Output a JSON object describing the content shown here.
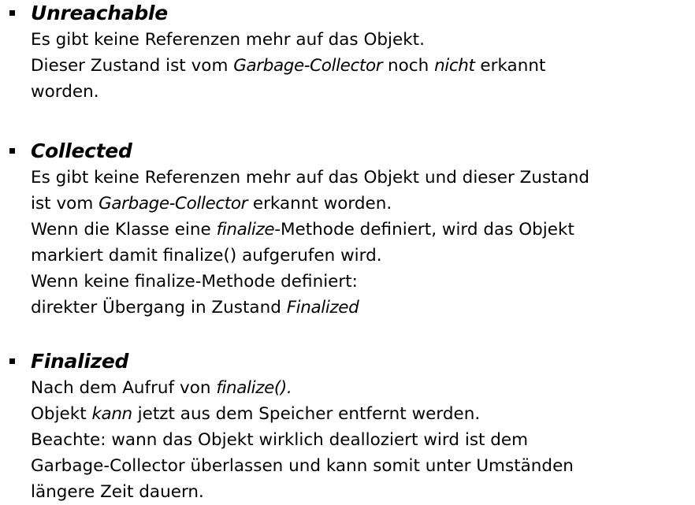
{
  "sections": [
    {
      "heading": "Unreachable",
      "lines": [
        [
          {
            "t": "Es gibt keine Referenzen mehr auf das Objekt."
          }
        ],
        [
          {
            "t": "Dieser Zustand ist vom "
          },
          {
            "t": "Garbage-Collector",
            "i": true
          },
          {
            "t": " noch "
          },
          {
            "t": "nicht",
            "i": true
          },
          {
            "t": " erkannt"
          }
        ],
        [
          {
            "t": "worden."
          }
        ]
      ]
    },
    {
      "heading": "Collected",
      "lines": [
        [
          {
            "t": "Es gibt keine Referenzen mehr auf das Objekt und dieser Zustand"
          }
        ],
        [
          {
            "t": "ist vom "
          },
          {
            "t": "Garbage-Collector",
            "i": true
          },
          {
            "t": " erkannt worden."
          }
        ],
        [
          {
            "t": "Wenn die Klasse eine "
          },
          {
            "t": "finalize",
            "i": true
          },
          {
            "t": "-Methode definiert, wird das Objekt"
          }
        ],
        [
          {
            "t": "markiert damit finalize() aufgerufen wird."
          }
        ],
        [
          {
            "t": "Wenn keine finalize-Methode definiert:"
          }
        ],
        [
          {
            "t": "direkter Übergang in Zustand "
          },
          {
            "t": "Finalized",
            "i": true
          }
        ]
      ]
    },
    {
      "heading": "Finalized",
      "lines": [
        [
          {
            "t": "Nach dem Aufruf von "
          },
          {
            "t": "finalize().",
            "i": true
          }
        ],
        [
          {
            "t": "Objekt "
          },
          {
            "t": "kann",
            "i": true
          },
          {
            "t": " jetzt aus dem Speicher entfernt werden."
          }
        ],
        [
          {
            "t": "Beachte: wann das Objekt wirklich dealloziert wird ist dem"
          }
        ],
        [
          {
            "t": "Garbage-Collector überlassen und kann somit unter Umständen"
          }
        ],
        [
          {
            "t": "längere Zeit dauern."
          }
        ]
      ]
    }
  ]
}
